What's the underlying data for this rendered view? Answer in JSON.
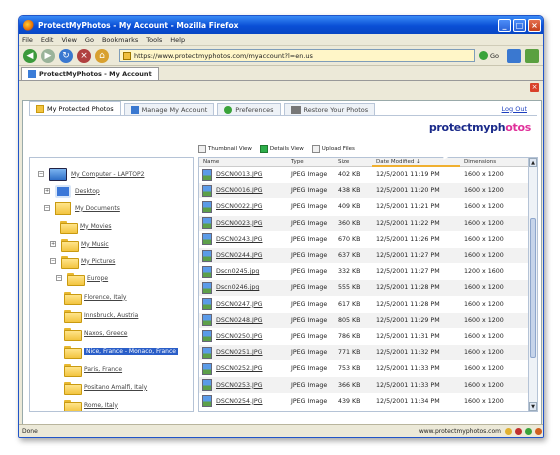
{
  "window": {
    "title": "ProtectMyPhotos - My Account - Mozilla Firefox",
    "menu": [
      "File",
      "Edit",
      "View",
      "Go",
      "Bookmarks",
      "Tools",
      "Help"
    ],
    "url": "https://www.protectmyphotos.com/myaccount?l=en.us",
    "go_label": "Go",
    "tab_title": "ProtectMyPhotos - My Account",
    "status_text": "Done",
    "status_host": "www.protectmyphotos.com"
  },
  "app": {
    "tabs": [
      "My Protected Photos",
      "Manage My Account",
      "Preferences",
      "Restore Your Photos"
    ],
    "logout": "Log Out",
    "logo_a": "protectmyph",
    "logo_b": "otos",
    "views": [
      "Thumbnail View",
      "Details View",
      "Upload Files"
    ]
  },
  "tree": [
    {
      "label": "My Computer - LAPTOP2"
    },
    {
      "label": "Desktop"
    },
    {
      "label": "My Documents"
    },
    {
      "label": "My Movies"
    },
    {
      "label": "My Music"
    },
    {
      "label": "My Pictures"
    },
    {
      "label": "Europe"
    },
    {
      "label": "Florence, Italy"
    },
    {
      "label": "Innsbruck, Austria"
    },
    {
      "label": "Naxos, Greece"
    },
    {
      "label": "Nice, France - Monaco, France"
    },
    {
      "label": "Paris, France"
    },
    {
      "label": "Positano Amalfi, Italy"
    },
    {
      "label": "Rome, Italy"
    }
  ],
  "grid": {
    "headers": [
      "Name",
      "Type",
      "Size",
      "Date Modified ↓",
      "Dimensions"
    ],
    "rows": [
      [
        "DSCN0013.JPG",
        "JPEG Image",
        "402 KB",
        "12/5/2001 11:19 PM",
        "1600 x 1200"
      ],
      [
        "DSCN0016.JPG",
        "JPEG Image",
        "438 KB",
        "12/5/2001 11:20 PM",
        "1600 x 1200"
      ],
      [
        "DSCN0022.JPG",
        "JPEG Image",
        "409 KB",
        "12/5/2001 11:21 PM",
        "1600 x 1200"
      ],
      [
        "DSCN0023.JPG",
        "JPEG Image",
        "360 KB",
        "12/5/2001 11:22 PM",
        "1600 x 1200"
      ],
      [
        "DSCN0243.JPG",
        "JPEG Image",
        "670 KB",
        "12/5/2001 11:26 PM",
        "1600 x 1200"
      ],
      [
        "DSCN0244.JPG",
        "JPEG Image",
        "637 KB",
        "12/5/2001 11:27 PM",
        "1600 x 1200"
      ],
      [
        "Dscn0245.jpg",
        "JPEG Image",
        "332 KB",
        "12/5/2001 11:27 PM",
        "1200 x 1600"
      ],
      [
        "Dscn0246.jpg",
        "JPEG Image",
        "555 KB",
        "12/5/2001 11:28 PM",
        "1600 x 1200"
      ],
      [
        "DSCN0247.JPG",
        "JPEG Image",
        "617 KB",
        "12/5/2001 11:28 PM",
        "1600 x 1200"
      ],
      [
        "DSCN0248.JPG",
        "JPEG Image",
        "805 KB",
        "12/5/2001 11:29 PM",
        "1600 x 1200"
      ],
      [
        "DSCN0250.JPG",
        "JPEG Image",
        "786 KB",
        "12/5/2001 11:31 PM",
        "1600 x 1200"
      ],
      [
        "DSCN0251.JPG",
        "JPEG Image",
        "771 KB",
        "12/5/2001 11:32 PM",
        "1600 x 1200"
      ],
      [
        "DSCN0252.JPG",
        "JPEG Image",
        "753 KB",
        "12/5/2001 11:33 PM",
        "1600 x 1200"
      ],
      [
        "DSCN0253.JPG",
        "JPEG Image",
        "366 KB",
        "12/5/2001 11:33 PM",
        "1600 x 1200"
      ],
      [
        "DSCN0254.JPG",
        "JPEG Image",
        "439 KB",
        "12/5/2001 11:34 PM",
        "1600 x 1200"
      ]
    ]
  }
}
